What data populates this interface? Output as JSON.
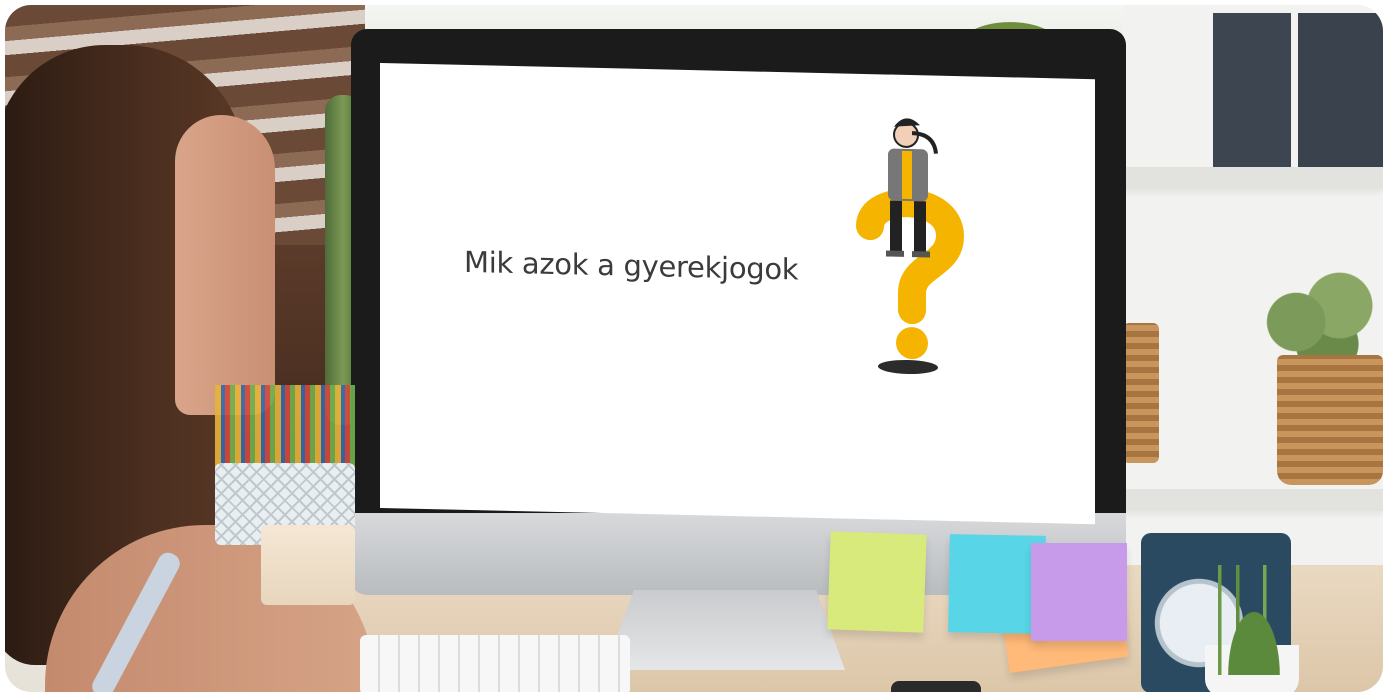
{
  "screen": {
    "title": "Mik azok a gyerekjogok"
  },
  "illustration": {
    "accent_color": "#F4B400",
    "figure_icon": "thinking-person-on-question-mark"
  },
  "colors": {
    "sticky_green": "#D7EA7B",
    "sticky_cyan": "#58D5E6",
    "sticky_purple": "#C79BE9",
    "sticky_orange": "#FFB978"
  }
}
